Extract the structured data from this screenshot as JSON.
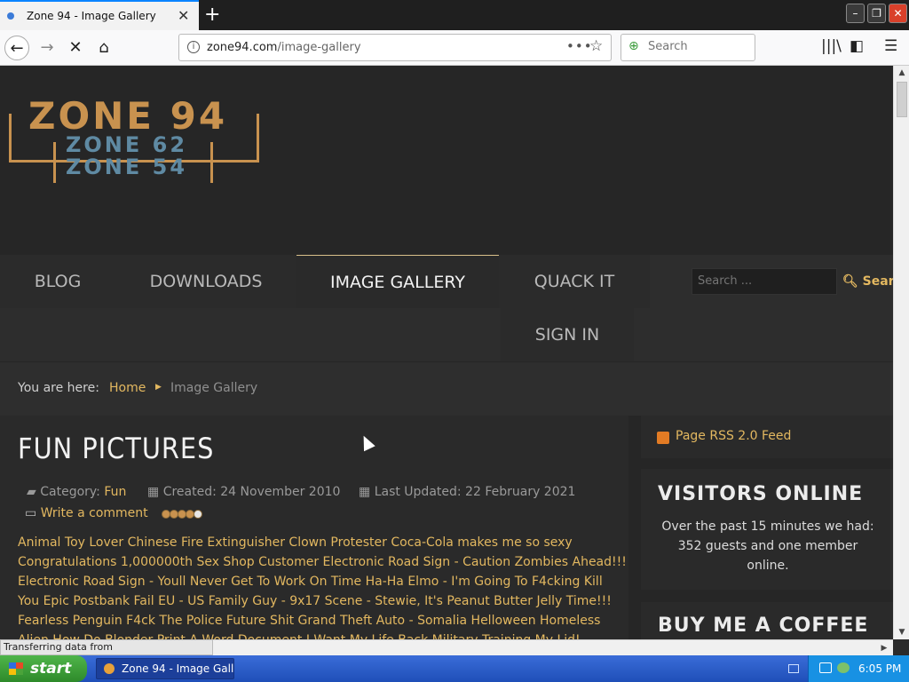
{
  "browser": {
    "tab_title": "Zone 94 - Image Gallery",
    "url_domain": "zone94.com",
    "url_path": "/image-gallery",
    "search_placeholder": "Search",
    "status_text": "Transferring data from www.paypalobjects.com..."
  },
  "site": {
    "logo_lines": [
      "ZONE 94",
      "ZONE 62",
      "ZONE 54"
    ],
    "menu": [
      "BLOG",
      "DOWNLOADS",
      "IMAGE GALLERY",
      "QUACK IT",
      "SIGN IN"
    ],
    "active_menu": "IMAGE GALLERY",
    "search_placeholder": "Search ...",
    "search_button": "Search"
  },
  "breadcrumb": {
    "label": "You are here:",
    "home": "Home",
    "current": "Image Gallery"
  },
  "article": {
    "title": "FUN PICTURES",
    "category_label": "Category:",
    "category": "Fun",
    "created": "Created: 24 November 2010",
    "updated": "Last Updated: 22 February 2021",
    "write_comment": "Write a comment",
    "rating": 4,
    "rating_max": 5,
    "lines": [
      "Animal Toy Lover Chinese Fire Extinguisher Clown Protester Coca-Cola makes me so sexy",
      "Congratulations 1,000000th Sex Shop Customer Electronic Road Sign - Caution Zombies Ahead!!!",
      "Electronic Road Sign - Youll Never Get To Work On Time Ha-Ha Elmo - I'm Going To F4cking Kill",
      "You Epic Postbank Fail EU - US Family Guy - 9x17 Scene - Stewie, It's Peanut Butter Jelly Time!!!",
      "Fearless Penguin F4ck The Police Future Shit Grand Theft Auto - Somalia Helloween Homeless",
      "Alien How Do Blonder Print A Word Document I Want My Life Back Military Training My Lid!"
    ]
  },
  "sidebar": {
    "rss": "Page RSS 2.0 Feed",
    "visitors_title": "VISITORS ONLINE",
    "visitors_text": "Over the past 15 minutes we had: 352 guests and one member online.",
    "coffee_title": "BUY ME A COFFEE"
  },
  "taskbar": {
    "start": "start",
    "task": "Zone 94 - Image Gall...",
    "clock": "6:05 PM"
  }
}
